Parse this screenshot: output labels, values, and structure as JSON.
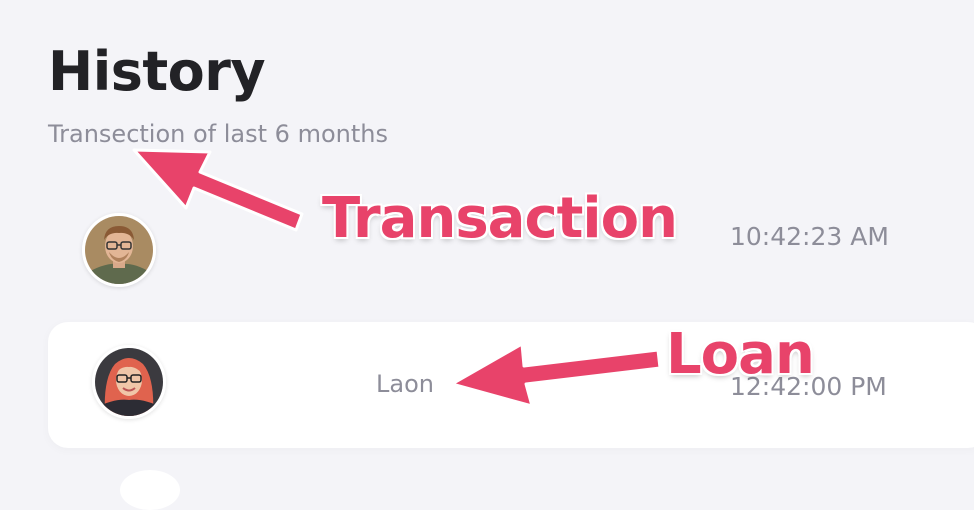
{
  "header": {
    "title": "History",
    "subtitle": "Transection of last 6 months"
  },
  "transactions": [
    {
      "avatar": "man-with-glasses-avatar",
      "type": "",
      "time": "10:42:23 AM"
    },
    {
      "avatar": "woman-with-glasses-avatar",
      "type": "Laon",
      "time": "12:42:00 PM"
    }
  ],
  "annotations": {
    "transaction": "Transaction",
    "loan": "Loan"
  },
  "colors": {
    "background": "#f4f4f8",
    "card": "#ffffff",
    "title": "#222226",
    "muted_text": "#8d8d99",
    "annotation": "#e8436a"
  }
}
